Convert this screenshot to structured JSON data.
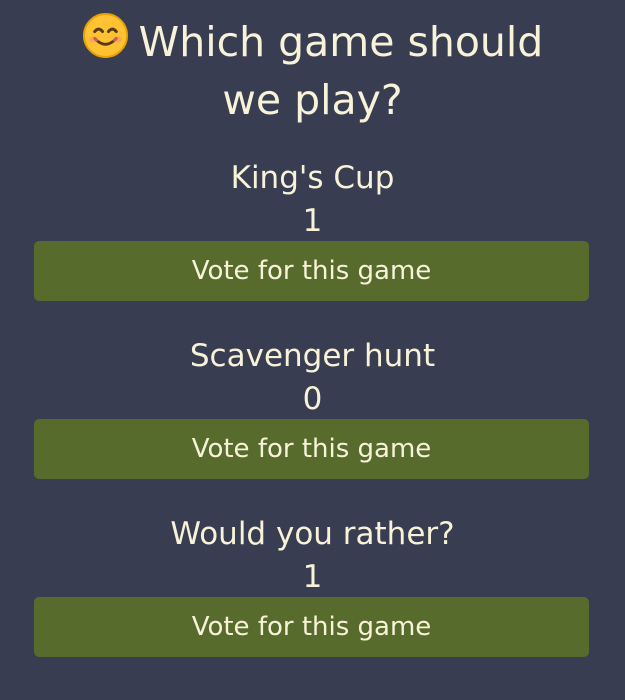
{
  "header": {
    "icon": "smiling-face-icon",
    "title_line1": "Which game should",
    "title_line2": "we play?"
  },
  "colors": {
    "background": "#383d51",
    "text": "#f7f2d8",
    "button": "#576b2d"
  },
  "options": [
    {
      "name": "King's Cup",
      "votes": "1",
      "button_label": "Vote for this game"
    },
    {
      "name": "Scavenger hunt",
      "votes": "0",
      "button_label": "Vote for this game"
    },
    {
      "name": "Would you rather?",
      "votes": "1",
      "button_label": "Vote for this game"
    }
  ]
}
